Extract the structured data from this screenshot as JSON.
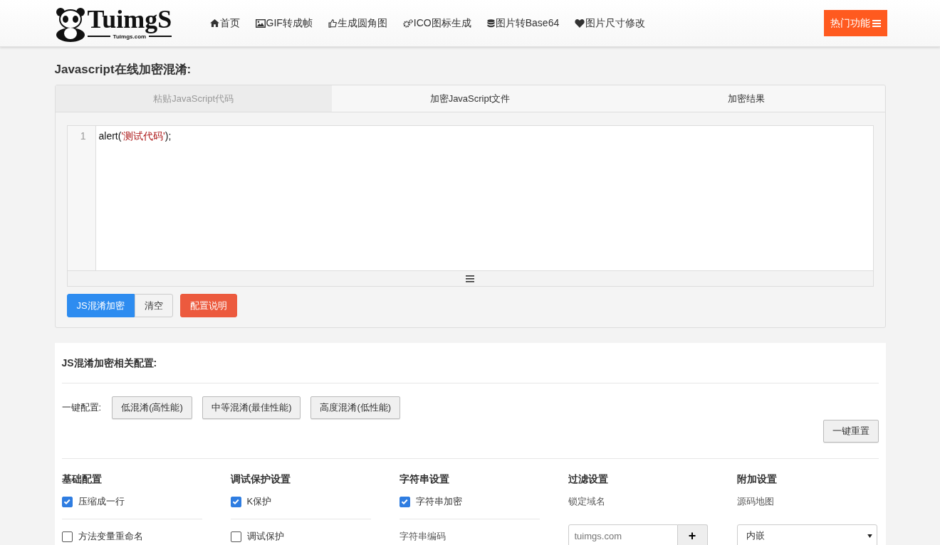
{
  "header": {
    "logo": {
      "name": "TuimgS",
      "domain": "Tuimgs.com"
    },
    "nav": [
      {
        "label": "首页",
        "kind": "home"
      },
      {
        "label": "GIF转成帧",
        "kind": "image"
      },
      {
        "label": "生成圆角图",
        "kind": "thumb"
      },
      {
        "label": "ICO图标生成",
        "kind": "gears"
      },
      {
        "label": "图片转Base64",
        "kind": "database"
      },
      {
        "label": "图片尺寸修改",
        "kind": "heart"
      }
    ],
    "hot_button": "热门功能"
  },
  "page_title": "Javascript在线加密混淆:",
  "tabs": [
    {
      "label": "粘贴JavaScript代码",
      "selected": true
    },
    {
      "label": "加密JavaScript文件",
      "selected": false
    },
    {
      "label": "加密结果",
      "selected": false
    }
  ],
  "editor": {
    "lines": [
      {
        "number": "1",
        "tokens": [
          {
            "text": "alert(",
            "kind": "plain"
          },
          {
            "text": "'测试代码'",
            "kind": "string"
          },
          {
            "text": ");",
            "kind": "plain"
          }
        ]
      }
    ]
  },
  "actions": [
    {
      "label": "JS混淆加密",
      "kind": "primary"
    },
    {
      "label": "清空",
      "kind": "default"
    },
    {
      "label": "配置说明",
      "kind": "danger"
    }
  ],
  "config": {
    "title": "JS混淆加密相关配置:",
    "preset_label": "一键配置:",
    "presets": [
      "低混淆(高性能)",
      "中等混淆(最佳性能)",
      "高度混淆(低性能)"
    ],
    "reset_button": "一键重置",
    "columns": [
      {
        "title": "基础配置",
        "items": [
          {
            "kind": "checkbox",
            "label": "压缩成一行",
            "checked": true
          },
          {
            "kind": "checkbox",
            "label": "方法变量重命名",
            "checked": false
          }
        ]
      },
      {
        "title": "调试保护设置",
        "items": [
          {
            "kind": "checkbox",
            "label": "K保护",
            "checked": true
          },
          {
            "kind": "checkbox",
            "label": "调试保护",
            "checked": false
          }
        ]
      },
      {
        "title": "字符串设置",
        "items": [
          {
            "kind": "checkbox",
            "label": "字符串加密",
            "checked": true
          },
          {
            "kind": "label",
            "label": "字符串编码"
          }
        ]
      },
      {
        "title": "过滤设置",
        "items": [
          {
            "kind": "label",
            "label": "锁定域名"
          },
          {
            "kind": "input",
            "placeholder": "tuimgs.com",
            "button": "+"
          }
        ]
      },
      {
        "title": "附加设置",
        "items": [
          {
            "kind": "label",
            "label": "源码地图"
          },
          {
            "kind": "select",
            "value": "内嵌"
          }
        ]
      }
    ]
  }
}
